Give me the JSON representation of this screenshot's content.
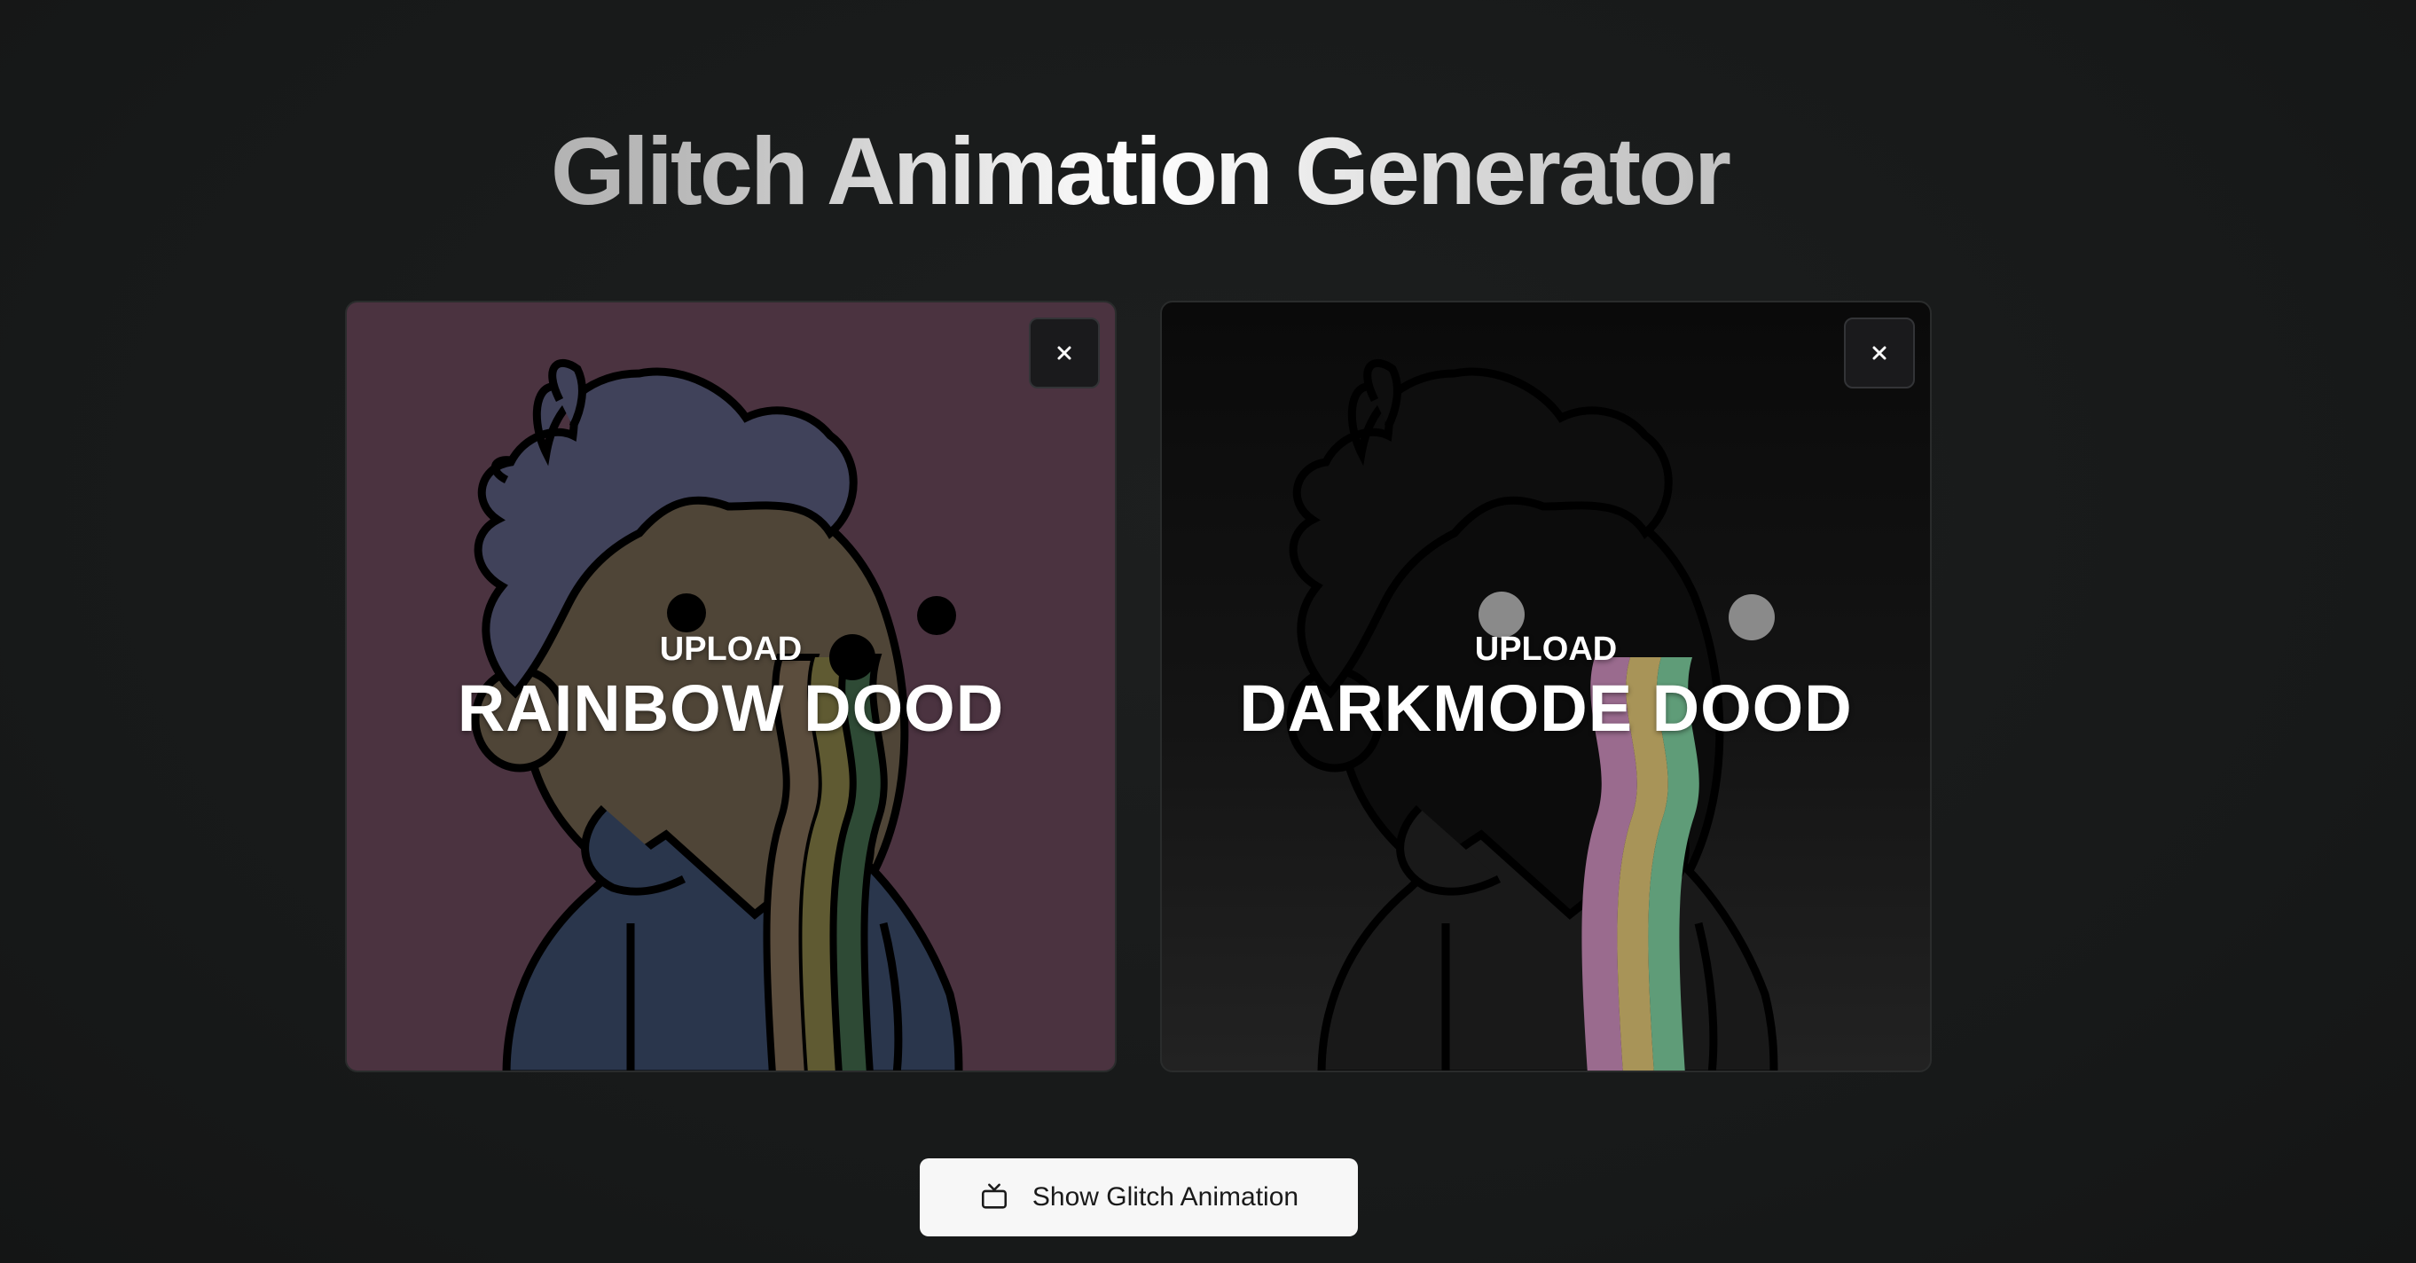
{
  "page": {
    "title": "Glitch Animation Generator"
  },
  "cards": [
    {
      "upload_small": "UPLOAD",
      "upload_big": "RAINBOW DOOD",
      "background": "#4b3340",
      "close_icon": "close-icon"
    },
    {
      "upload_small": "UPLOAD",
      "upload_big": "DARKMODE DOOD",
      "background": "#121212",
      "close_icon": "close-icon"
    }
  ],
  "actions": {
    "show_glitch_label": "Show Glitch Animation",
    "show_glitch_icon": "tv-icon"
  },
  "colors": {
    "page_background": "#181a1a",
    "button_background": "#f7f7f7",
    "rainbow_pink": "#b07aa8",
    "rainbow_yellow": "#b0a060",
    "rainbow_green": "#5fa47c"
  }
}
